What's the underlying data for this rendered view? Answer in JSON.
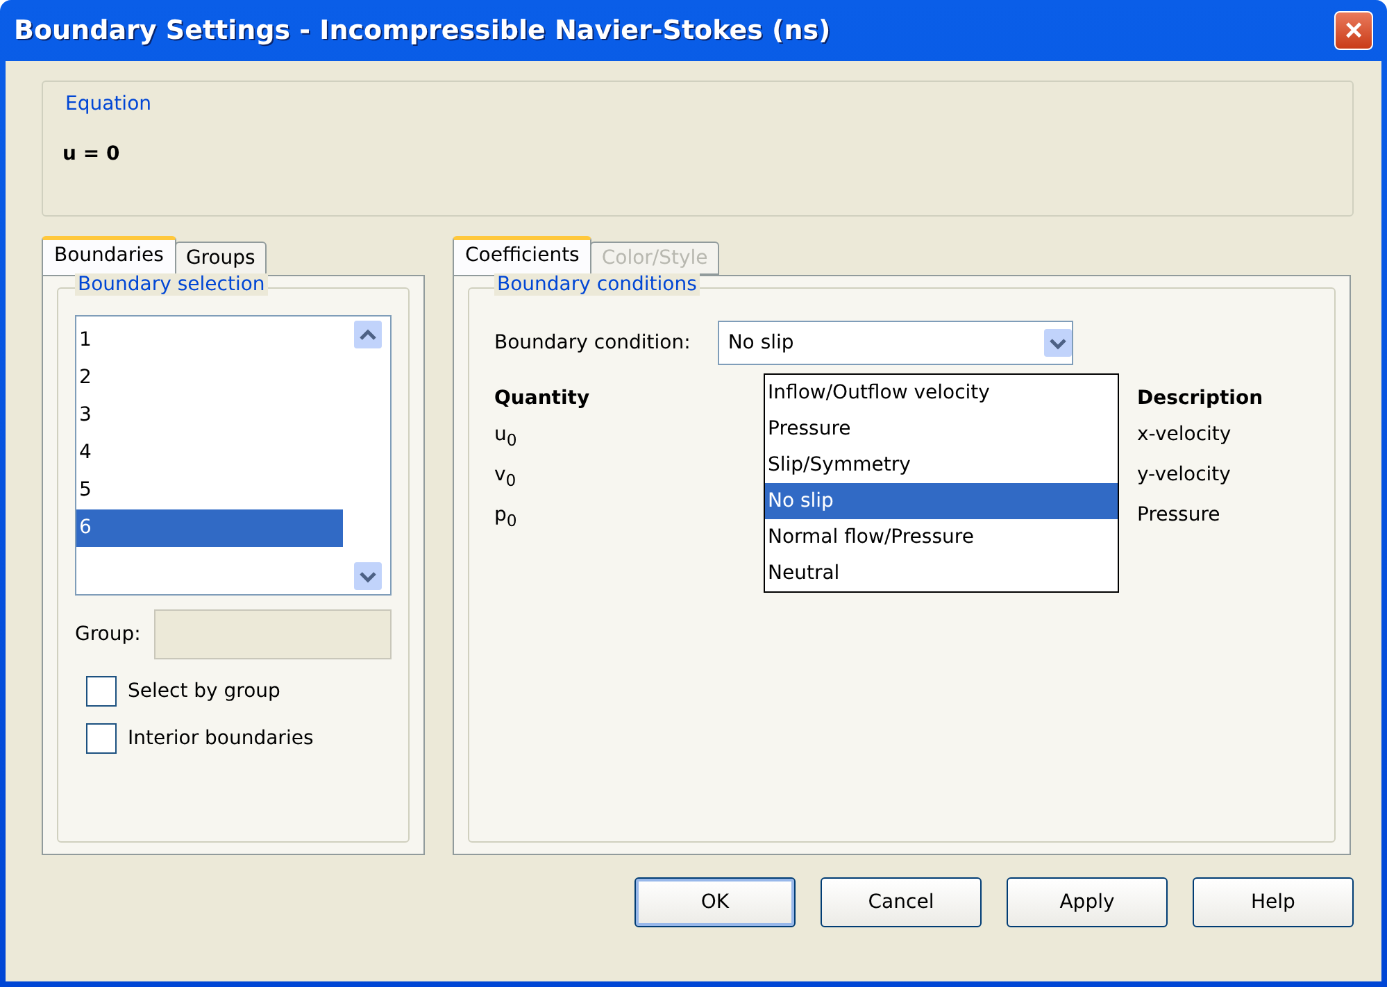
{
  "window": {
    "title": "Boundary Settings - Incompressible Navier-Stokes (ns)",
    "close": "×"
  },
  "equation": {
    "legend": "Equation",
    "formula": "u = 0"
  },
  "left_tabs": [
    {
      "label": "Boundaries",
      "selected": true
    },
    {
      "label": "Groups",
      "selected": false
    }
  ],
  "boundary_selection": {
    "legend": "Boundary selection",
    "items": [
      {
        "label": "1",
        "selected": false
      },
      {
        "label": "2",
        "selected": false
      },
      {
        "label": "3",
        "selected": false
      },
      {
        "label": "4",
        "selected": false
      },
      {
        "label": "5",
        "selected": false
      },
      {
        "label": "6",
        "selected": true
      }
    ],
    "group_label": "Group:",
    "group_disabled": true,
    "checkboxes": [
      {
        "label": "Select by group",
        "checked": false
      },
      {
        "label": "Interior boundaries",
        "checked": false
      }
    ]
  },
  "right_tabs": [
    {
      "label": "Coefficients",
      "selected": true,
      "disabled": false
    },
    {
      "label": "Color/Style",
      "selected": false,
      "disabled": true
    }
  ],
  "boundary_conditions": {
    "legend": "Boundary conditions",
    "label": "Boundary condition:",
    "value": "No slip",
    "options": [
      {
        "label": "Inflow/Outflow velocity",
        "selected": false
      },
      {
        "label": "Pressure",
        "selected": false
      },
      {
        "label": "Slip/Symmetry",
        "selected": false
      },
      {
        "label": "No slip",
        "selected": true
      },
      {
        "label": "Normal flow/Pressure",
        "selected": false
      },
      {
        "label": "Neutral",
        "selected": false
      }
    ],
    "columns": [
      "Quantity",
      "Description"
    ],
    "rows": [
      {
        "quantity": "u$_{0}$",
        "description": "x-velocity"
      },
      {
        "quantity": "v$_{0}$",
        "description": "y-velocity"
      },
      {
        "quantity": "p$_{0}$",
        "description": "Pressure"
      }
    ]
  },
  "buttons": [
    {
      "label": "OK",
      "default": true
    },
    {
      "label": "Cancel",
      "default": false
    },
    {
      "label": "Apply",
      "default": false
    },
    {
      "label": "Help",
      "default": false
    }
  ]
}
